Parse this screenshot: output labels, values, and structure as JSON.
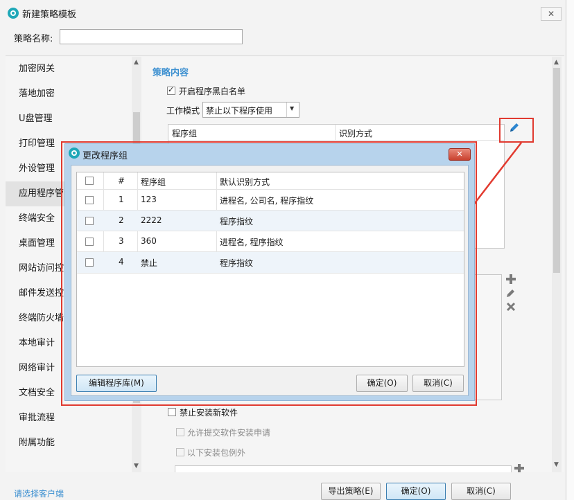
{
  "window": {
    "title": "新建策略模板",
    "close": "✕"
  },
  "policy_name": {
    "label": "策略名称:",
    "value": ""
  },
  "sidebar": {
    "items": [
      {
        "label": "加密网关"
      },
      {
        "label": "落地加密"
      },
      {
        "label": "U盘管理"
      },
      {
        "label": "打印管理"
      },
      {
        "label": "外设管理"
      },
      {
        "label": "应用程序管"
      },
      {
        "label": "终端安全"
      },
      {
        "label": "桌面管理"
      },
      {
        "label": "网站访问控"
      },
      {
        "label": "邮件发送控"
      },
      {
        "label": "终端防火墙"
      },
      {
        "label": "本地审计"
      },
      {
        "label": "网络审计"
      },
      {
        "label": "文档安全"
      },
      {
        "label": "审批流程"
      },
      {
        "label": "附属功能"
      }
    ],
    "selected_index": 5
  },
  "content": {
    "section_title": "策略内容",
    "whitelist_checkbox": {
      "label": "开启程序黑白名单",
      "checked": true
    },
    "work_mode": {
      "label": "工作模式",
      "value": "禁止以下程序使用"
    },
    "program_table_headers": [
      "程序组",
      "识别方式"
    ],
    "lower_table_headers": [
      "",
      ""
    ],
    "block_install": {
      "label": "禁止安装新软件",
      "checked": false
    },
    "allow_submit": {
      "label": "允许提交软件安装申请",
      "checked": false
    },
    "except_packages": {
      "label": "以下安装包例外",
      "checked": false
    }
  },
  "dialog": {
    "title": "更改程序组",
    "close": "✕",
    "headers": [
      "#",
      "程序组",
      "默认识别方式"
    ],
    "rows": [
      {
        "num": "1",
        "group": "123",
        "method": "进程名, 公司名, 程序指纹"
      },
      {
        "num": "2",
        "group": "2222",
        "method": "程序指纹"
      },
      {
        "num": "3",
        "group": "360",
        "method": "进程名, 程序指纹"
      },
      {
        "num": "4",
        "group": "禁止",
        "method": "程序指纹"
      }
    ],
    "edit_library_button": "编辑程序库(M)",
    "ok_button": "确定(O)",
    "cancel_button": "取消(C)"
  },
  "footer": {
    "select_client_link": "请选择客户端",
    "export_button": "导出策略(E)",
    "ok_button": "确定(O)",
    "cancel_button": "取消(C)"
  },
  "icons": {
    "edit": "pencil-icon",
    "add": "plus-icon",
    "delete": "x-icon",
    "app": "app-logo-icon"
  },
  "colors": {
    "accent_link": "#3b8fd0",
    "highlight_red": "#e03a30",
    "dialog_frame": "#b7d3ec"
  }
}
